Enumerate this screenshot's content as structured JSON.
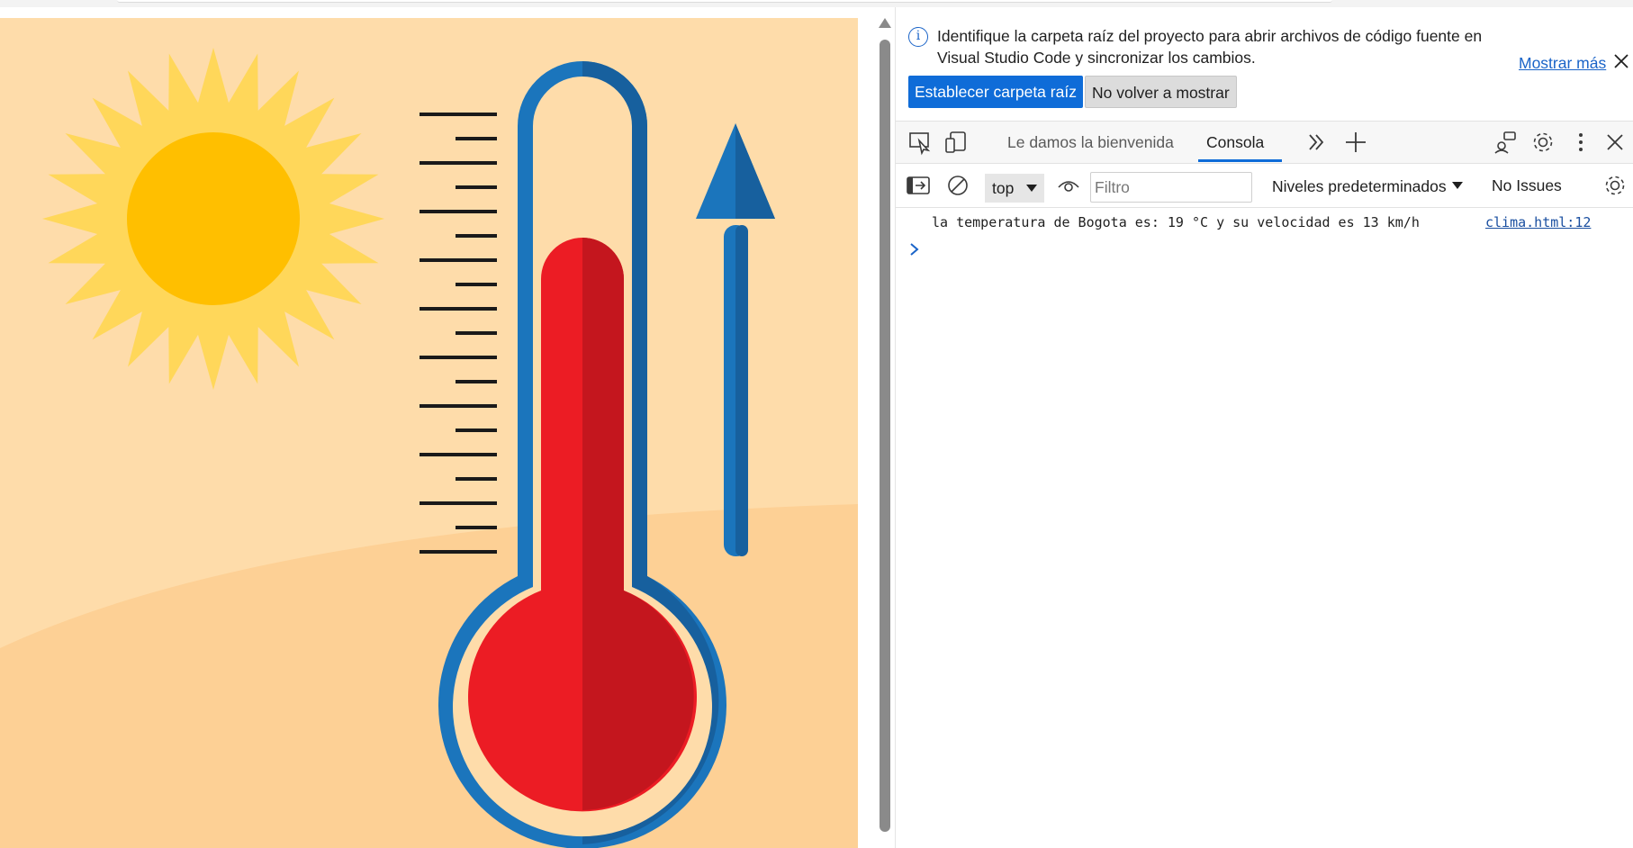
{
  "infobar": {
    "message": "Identifique la carpeta raíz del proyecto para abrir archivos de código fuente en Visual Studio Code y sincronizar los cambios.",
    "more_link": "Mostrar más",
    "primary_button": "Establecer carpeta raíz",
    "secondary_button": "No volver a mostrar"
  },
  "tabs": {
    "welcome": "Le damos la bienvenida",
    "console": "Consola"
  },
  "console_toolbar": {
    "context": "top",
    "filter_placeholder": "Filtro",
    "levels": "Niveles predeterminados",
    "issues": "No Issues"
  },
  "console": {
    "log_message": "la temperatura de Bogota es: 19 °C y su velocidad es 13 km/h",
    "log_source": "clima.html:12"
  },
  "colors": {
    "accent": "#0f6cd8",
    "page_background": "#fedcaa",
    "sun": "#ffbf00",
    "thermometer_red": "#ec1c24",
    "thermometer_blue": "#1b75bc"
  }
}
